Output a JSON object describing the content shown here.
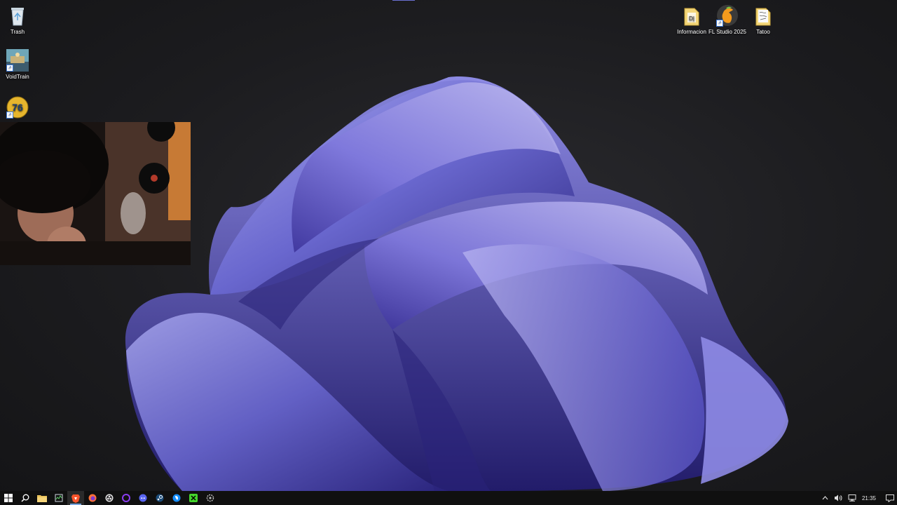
{
  "desktop": {
    "icons_left": [
      {
        "label": "Trash",
        "icon": "recycle-bin-icon"
      },
      {
        "label": "VoidTrain",
        "icon": "voidtrain-game-icon"
      },
      {
        "label": "",
        "icon": "fallout-76-icon"
      }
    ],
    "icons_right": [
      {
        "label": "Informacion",
        "icon": "folder-icon"
      },
      {
        "label": "FL Studio 2025",
        "icon": "fl-studio-icon"
      },
      {
        "label": "Tatoo",
        "icon": "folder-icon"
      }
    ],
    "wallpaper": "purple-ribbon-bloom",
    "accent": "#6c6fd6"
  },
  "webcam_overlay": {
    "description_icon": "webcam-feed"
  },
  "taskbar": {
    "apps": [
      {
        "name": "start",
        "icon": "windows-start-icon"
      },
      {
        "name": "search",
        "icon": "search-icon"
      },
      {
        "name": "file-explorer",
        "icon": "folder-icon"
      },
      {
        "name": "task-manager",
        "icon": "task-manager-icon"
      },
      {
        "name": "brave",
        "icon": "brave-browser-icon"
      },
      {
        "name": "firefox",
        "icon": "firefox-icon"
      },
      {
        "name": "obs",
        "icon": "obs-icon"
      },
      {
        "name": "purple-app",
        "icon": "purple-circle-icon"
      },
      {
        "name": "discord",
        "icon": "discord-icon"
      },
      {
        "name": "steam",
        "icon": "steam-icon"
      },
      {
        "name": "battle-net",
        "icon": "battlenet-icon"
      },
      {
        "name": "razer",
        "icon": "razer-icon"
      },
      {
        "name": "settings",
        "icon": "gear-icon"
      }
    ],
    "tray": {
      "clock": "21:35"
    }
  }
}
